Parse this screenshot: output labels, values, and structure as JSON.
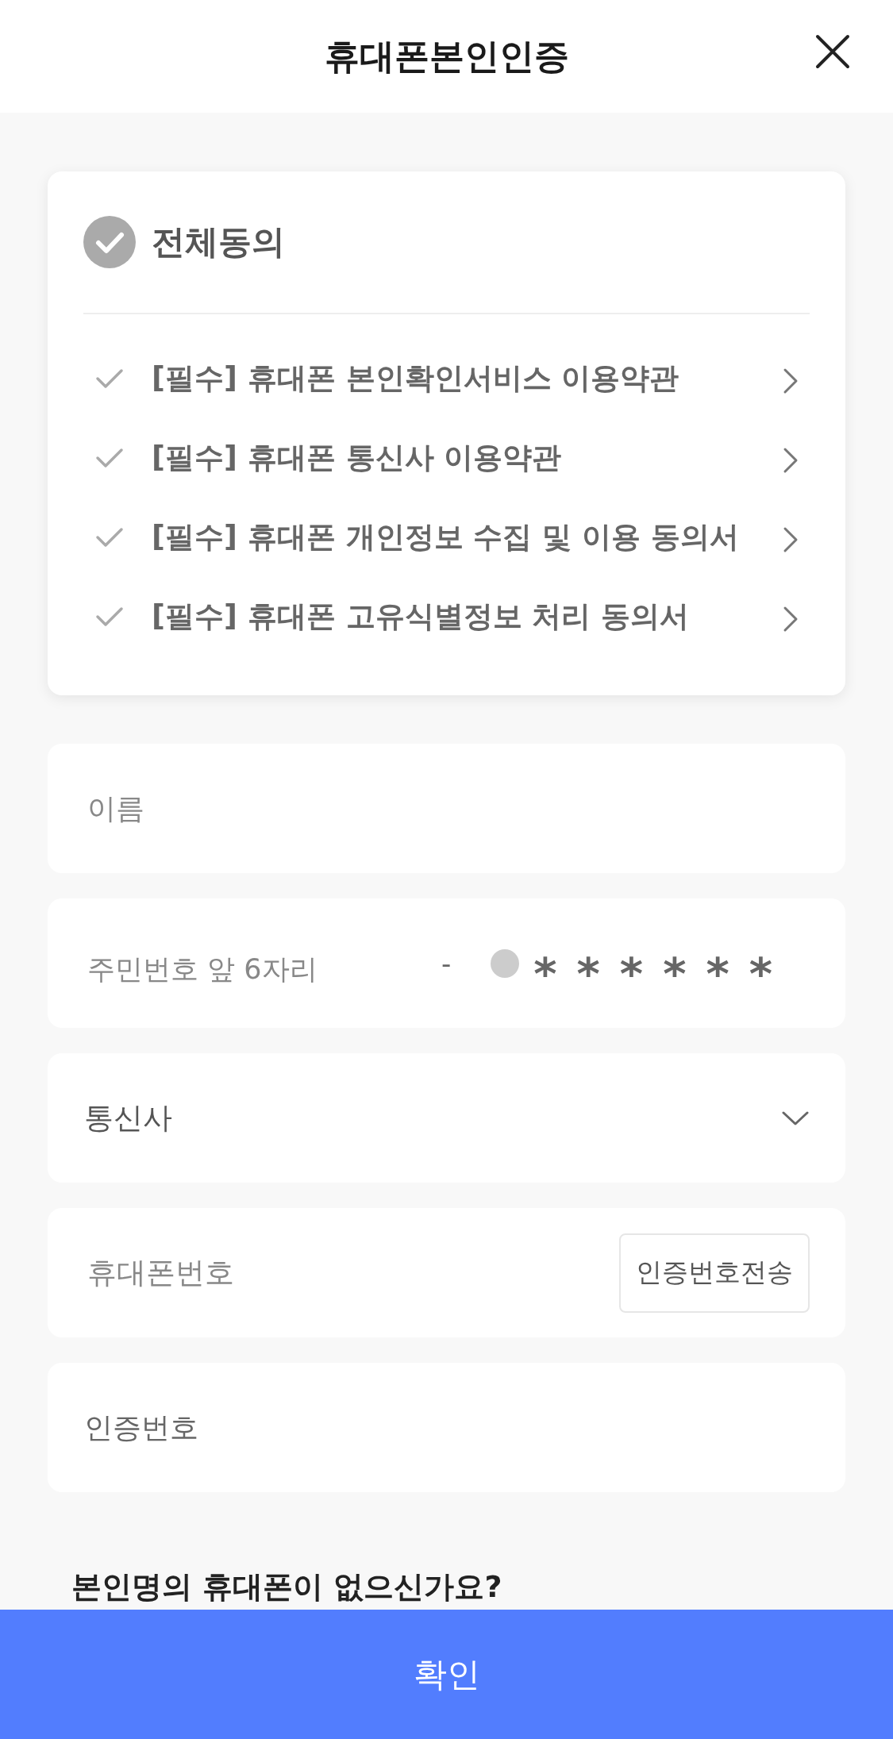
{
  "header": {
    "title": "휴대폰본인인증"
  },
  "consent": {
    "all": {
      "label": "전체동의",
      "checked": false
    },
    "terms": [
      {
        "label": "[필수] 휴대폰 본인확인서비스 이용약관",
        "checked": false
      },
      {
        "label": "[필수] 휴대폰 통신사 이용약관",
        "checked": false
      },
      {
        "label": "[필수] 휴대폰 개인정보 수집 및 이용 동의서",
        "checked": false
      },
      {
        "label": "[필수] 휴대폰 고유식별정보 처리 동의서",
        "checked": false
      }
    ]
  },
  "fields": [
    {
      "kind": "text",
      "placeholder": "이름"
    },
    {
      "kind": "rrn",
      "placeholder": "주민번호 앞 6자리",
      "separator": "-",
      "masked": "******"
    },
    {
      "kind": "select",
      "label": "통신사"
    },
    {
      "kind": "phone",
      "placeholder": "휴대폰번호",
      "button": "인증번호전송"
    },
    {
      "kind": "code",
      "placeholder": "인증번호"
    }
  ],
  "help_text": "본인명의 휴대폰이 없으신가요?",
  "confirm_button": "확인"
}
